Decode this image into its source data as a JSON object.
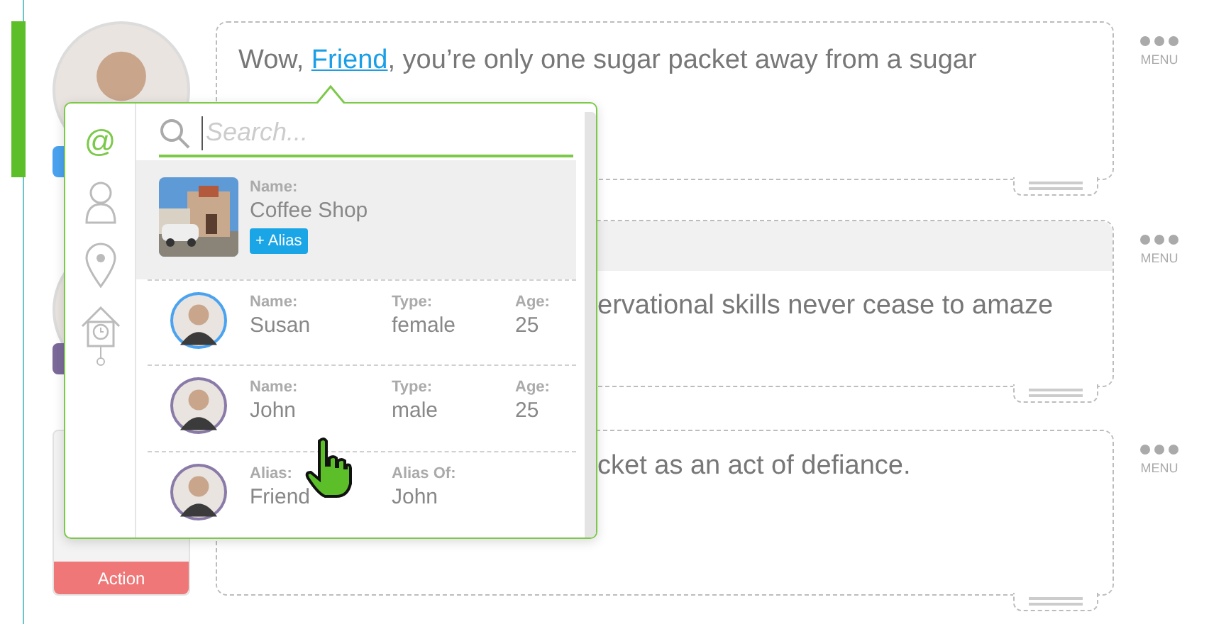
{
  "messages": [
    {
      "selected": true,
      "header_band": false,
      "sender": {
        "kind": "avatar",
        "color": "#4aa3f0"
      },
      "lines": [
        [
          {
            "text": "Wow, "
          },
          {
            "text": "Friend",
            "kind": "mention"
          },
          {
            "text": ", you’re only one sugar packet away from a sugar"
          }
        ]
      ],
      "menu_label": "MENU"
    },
    {
      "selected": false,
      "header_band": true,
      "sender": {
        "kind": "avatar",
        "color": "#7b6a9a"
      },
      "lines": [
        [
          {
            "text": "ervational skills never cease to amaze"
          }
        ]
      ],
      "menu_label": "MENU"
    },
    {
      "selected": false,
      "header_band": false,
      "sender": {
        "kind": "action",
        "label": "Action"
      },
      "lines": [
        [
          {
            "text": "cket as an act of defiance."
          }
        ]
      ],
      "menu_label": "MENU"
    }
  ],
  "mention_popup": {
    "categories": [
      {
        "kind": "symbol",
        "symbol": "@",
        "selected": true
      },
      {
        "kind": "person",
        "selected": false
      },
      {
        "kind": "place",
        "selected": false
      },
      {
        "kind": "house",
        "selected": false
      }
    ],
    "search": {
      "placeholder": "Search..."
    },
    "results": [
      {
        "kind": "place",
        "selected": true,
        "fields": [
          {
            "label": "Name:",
            "value": "Coffee Shop"
          }
        ],
        "tag": "+ Alias"
      },
      {
        "kind": "person",
        "selected": false,
        "color": "#4aa3f0",
        "fields": [
          {
            "label": "Name:",
            "value": "Susan"
          },
          {
            "label": "Type:",
            "value": "female"
          },
          {
            "label": "Age:",
            "value": "25"
          }
        ]
      },
      {
        "kind": "person",
        "selected": false,
        "color": "#8a7aa8",
        "fields": [
          {
            "label": "Name:",
            "value": "John"
          },
          {
            "label": "Type:",
            "value": "male"
          },
          {
            "label": "Age:",
            "value": "25"
          }
        ]
      },
      {
        "kind": "person",
        "selected": false,
        "color": "#8a7aa8",
        "fields": [
          {
            "label": "Alias:",
            "value": "Friend"
          },
          {
            "label": "Alias Of:",
            "value": "John"
          }
        ]
      }
    ]
  }
}
